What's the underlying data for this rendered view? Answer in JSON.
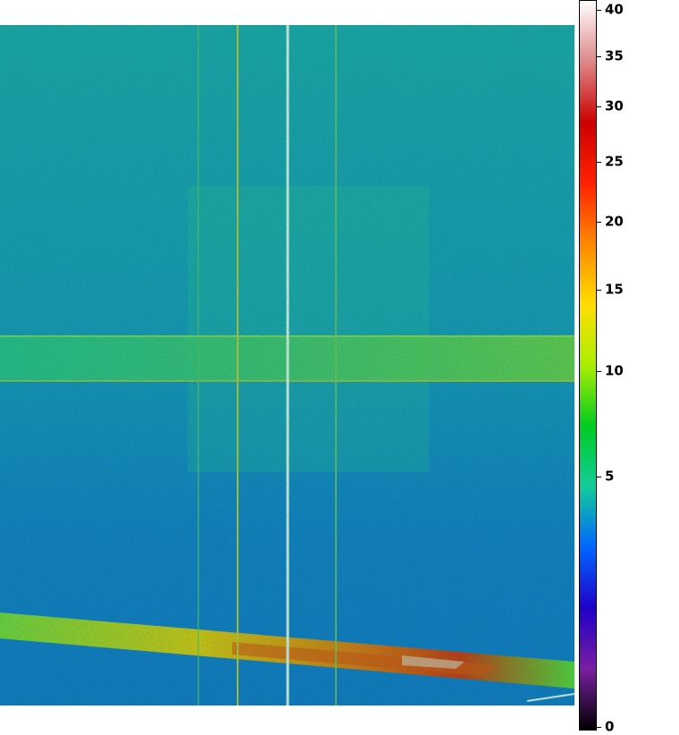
{
  "colorbar": {
    "ticks": [
      {
        "label": "40",
        "value": 40
      },
      {
        "label": "35",
        "value": 35
      },
      {
        "label": "30",
        "value": 30
      },
      {
        "label": "25",
        "value": 25
      },
      {
        "label": "20",
        "value": 20
      },
      {
        "label": "15",
        "value": 15
      },
      {
        "label": "10",
        "value": 10
      },
      {
        "label": "5",
        "value": 5
      },
      {
        "label": "0",
        "value": 0
      }
    ],
    "colors": [
      "#000000",
      "#7a1fa2",
      "#1f00c8",
      "#0066ff",
      "#11cc99",
      "#00cc22",
      "#aaee00",
      "#ffdd00",
      "#ff8800",
      "#ff2200",
      "#cc0000",
      "#dd8888",
      "#ffffff"
    ]
  },
  "image": {
    "background": "#1a8fd0",
    "features": [
      "horizontal green band",
      "diagonal red-orange streak",
      "vertical bright column lines"
    ]
  }
}
